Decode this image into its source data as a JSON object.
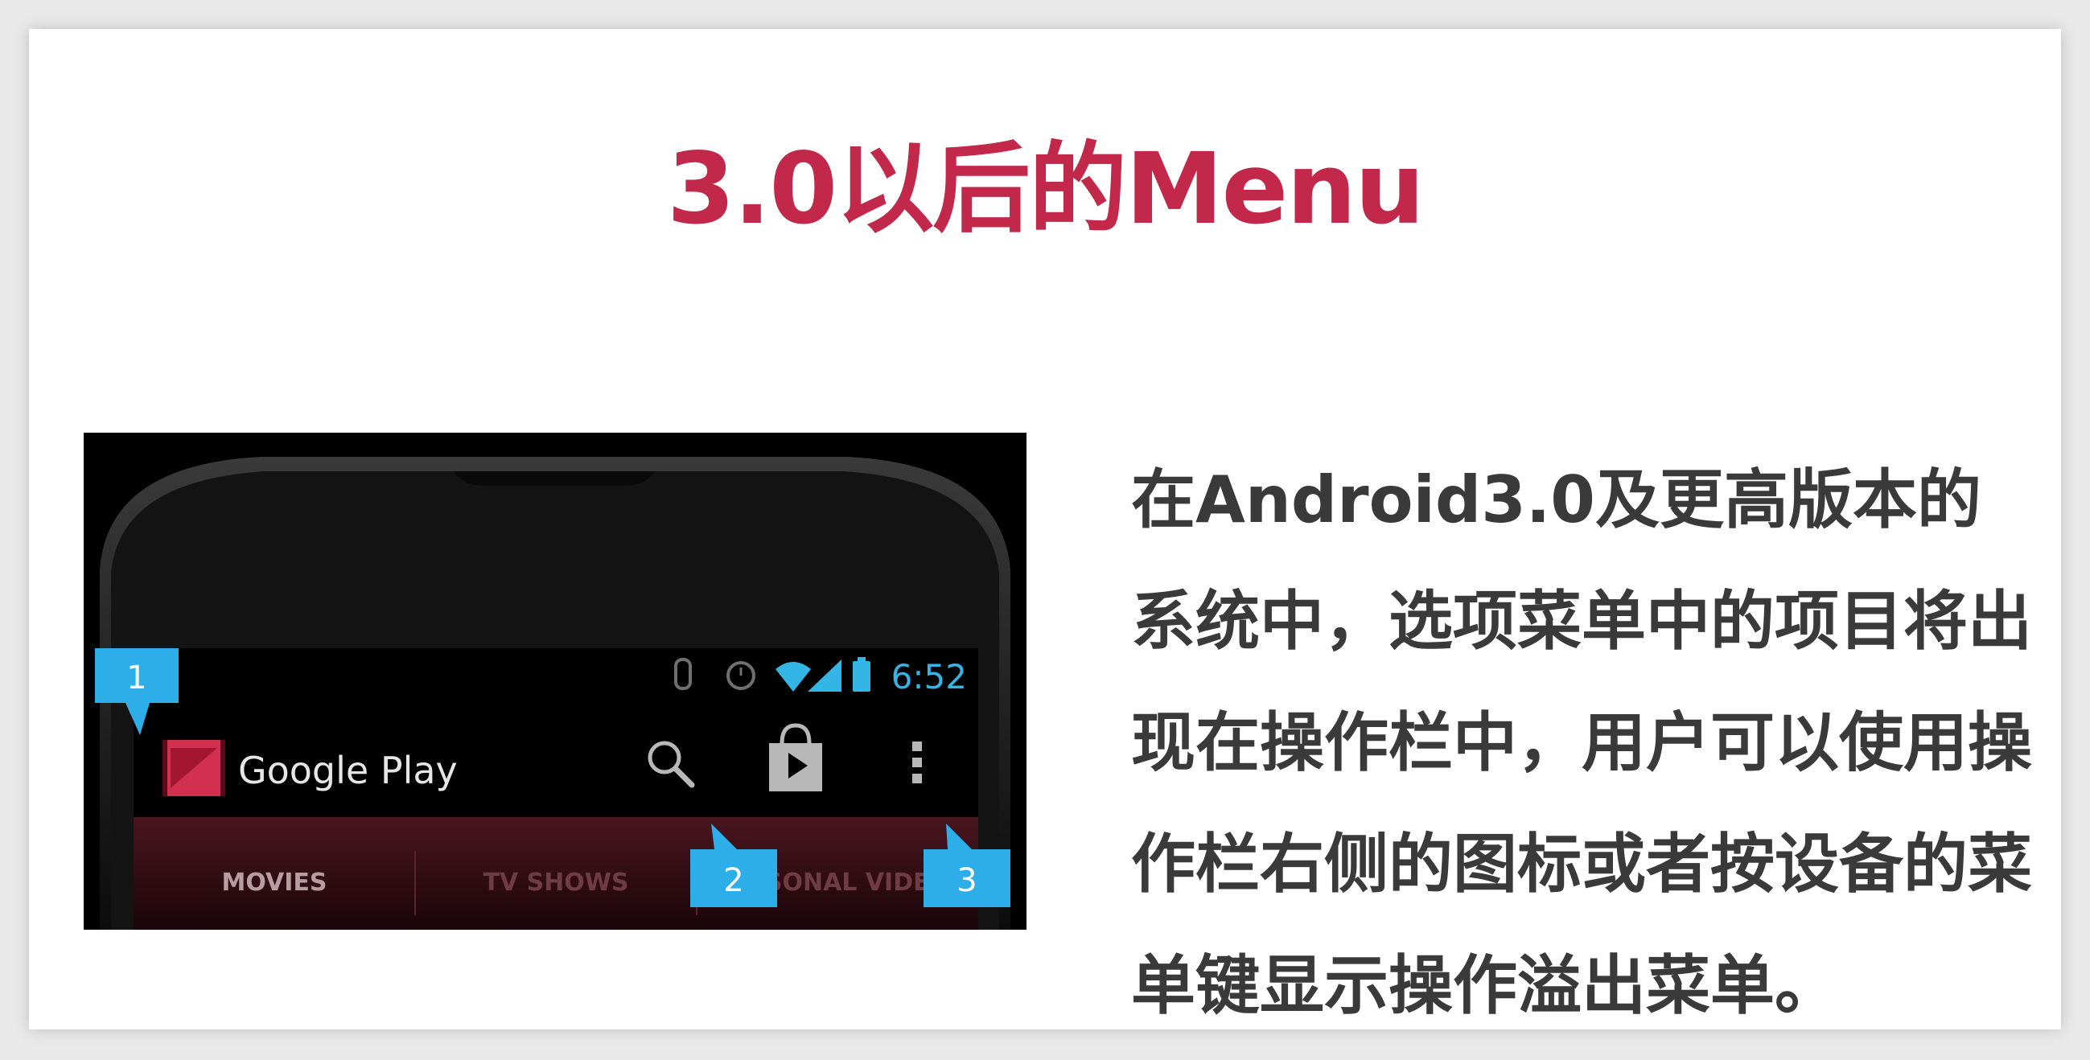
{
  "slide": {
    "title": "3.0以后的Menu",
    "description": "在Android3.0及更高版本的系统中，选项菜单中的项目将出现在操作栏中，用户可以使用操作栏右侧的图标或者按设备的菜单键显示操作溢出菜单。"
  },
  "phone": {
    "status_time": "6:52",
    "app_title": "Google Play",
    "tabs": [
      "MOVIES",
      "TV SHOWS",
      "PERSONAL VIDEOS"
    ],
    "callouts": [
      "1",
      "2",
      "3"
    ]
  },
  "colors": {
    "title": "#c1284a",
    "callout": "#2eaee8",
    "status_icons": "#33b5e5",
    "tab_bar": "#3a0e16"
  }
}
